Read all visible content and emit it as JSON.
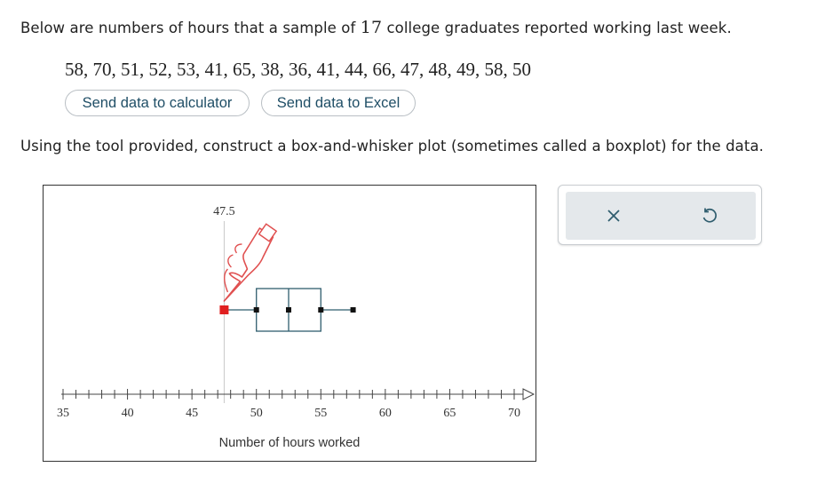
{
  "question": {
    "prefix": "Below are numbers of hours that a sample of",
    "sample_size": "17",
    "suffix": "college graduates reported working last week.",
    "data_values": "58, 70, 51, 52, 53, 41, 65, 38, 36, 41, 44, 66, 47, 48, 49, 58, 50",
    "instruction": "Using the tool provided, construct a box-and-whisker plot (sometimes called a boxplot) for the data."
  },
  "buttons": {
    "calculator": "Send data to calculator",
    "excel": "Send data to Excel"
  },
  "plot": {
    "axis_label": "Number of hours worked",
    "axis_min": 35,
    "axis_max": 70,
    "tick_labels": [
      "35",
      "40",
      "45",
      "50",
      "55",
      "60",
      "65",
      "70"
    ],
    "cursor_value_label": "47.5",
    "cursor_value": 47.5,
    "boxplot": {
      "min": 47.5,
      "q1": 50,
      "median": 52.5,
      "q3": 55,
      "max": 57.5
    },
    "colors": {
      "box": "#2f5d6e",
      "handle": "#111111",
      "selected_handle": "#e02020",
      "hand": "#e05050",
      "guide": "#c8c8c8"
    }
  },
  "tools": {
    "icons": [
      "close-icon",
      "undo-icon"
    ]
  }
}
